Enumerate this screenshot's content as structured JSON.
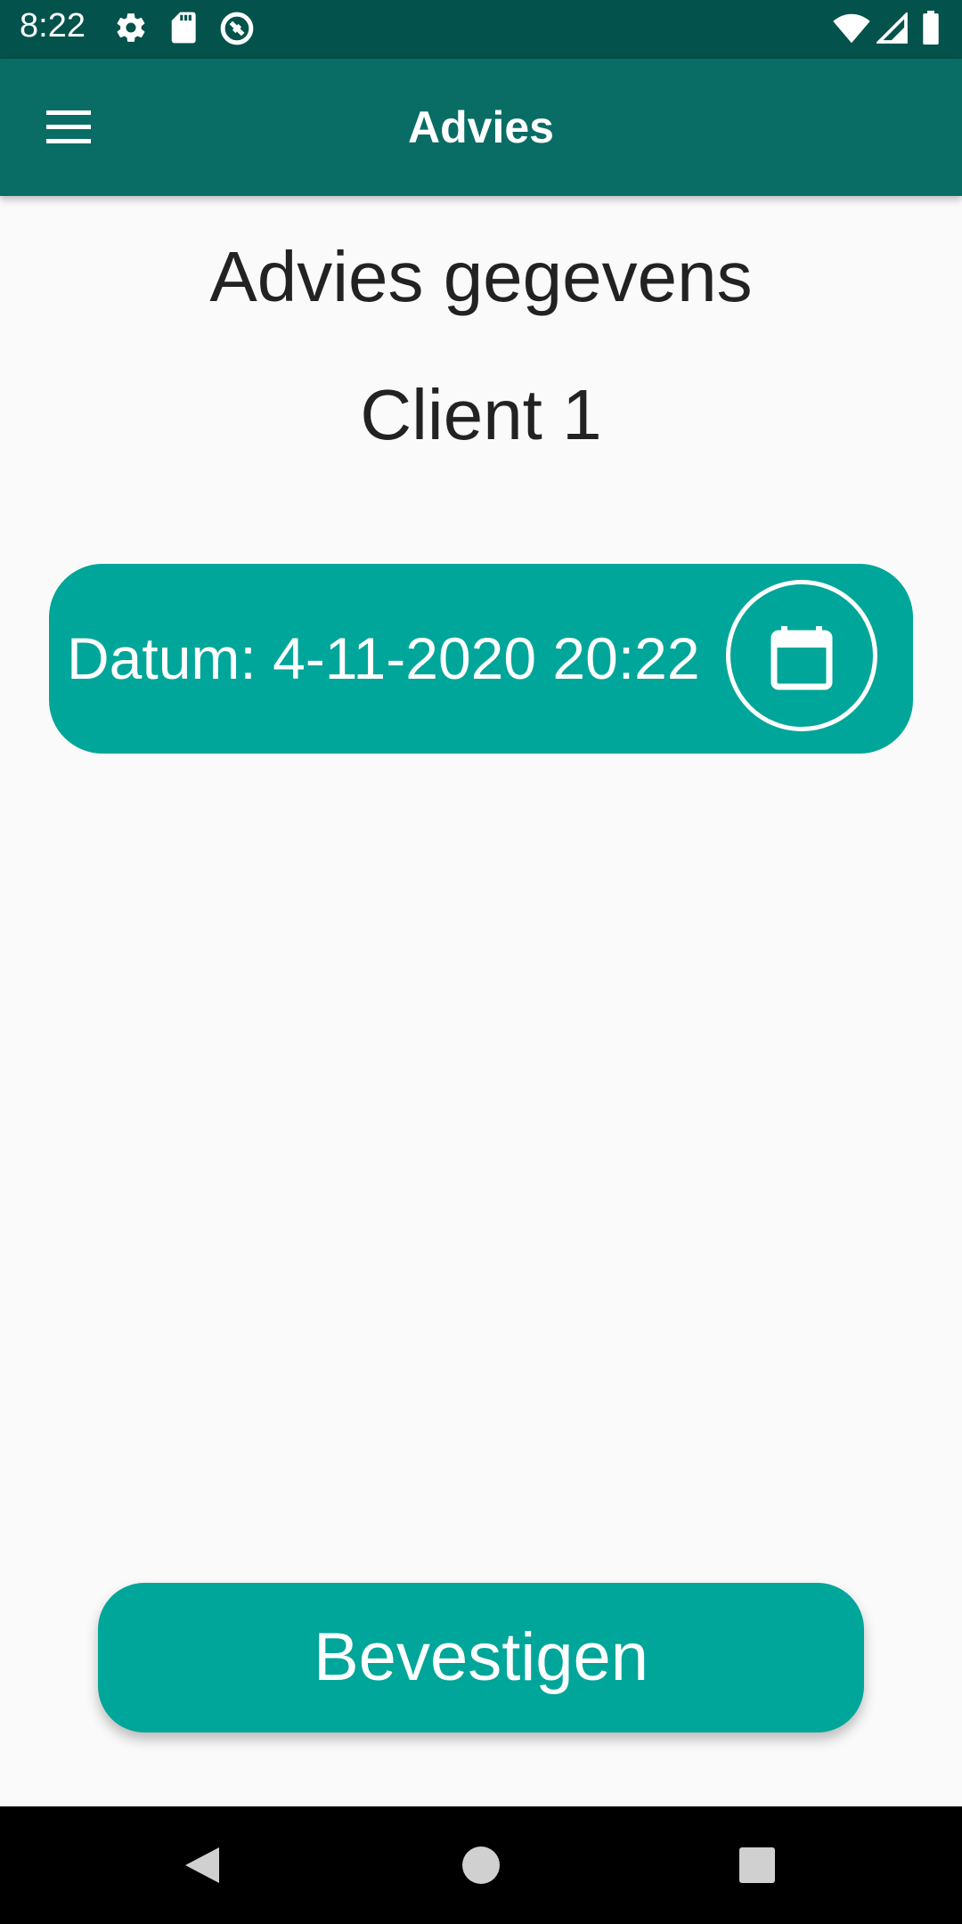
{
  "status_bar": {
    "time": "8:22",
    "left_icons": [
      "settings-icon",
      "sd-card-icon",
      "vpn-icon"
    ],
    "right_icons": [
      "wifi-icon",
      "signal-icon",
      "battery-icon"
    ]
  },
  "app_bar": {
    "title": "Advies",
    "menu_icon": "hamburger-menu-icon",
    "color": "#096d66"
  },
  "main": {
    "heading": "Advies gegevens",
    "client_name": "Client 1",
    "date_label": "Datum: 4-11-2020 20:22",
    "calendar_icon": "calendar-icon",
    "accent_color": "#00a699"
  },
  "footer": {
    "confirm_label": "Bevestigen"
  },
  "nav_bar": {
    "buttons": [
      "back-icon",
      "home-icon",
      "recents-icon"
    ]
  }
}
